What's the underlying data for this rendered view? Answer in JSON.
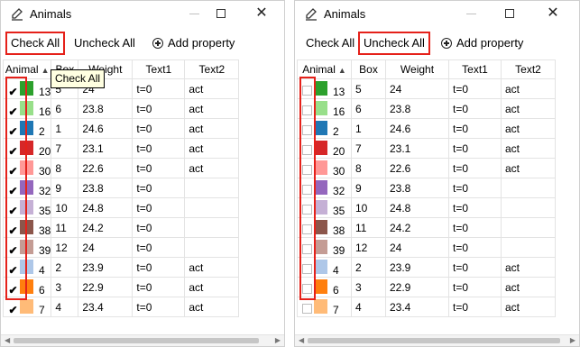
{
  "panels": [
    {
      "title": "Animals",
      "toolbar": {
        "check_all": "Check All",
        "uncheck_all": "Uncheck All",
        "add_property": "Add property"
      },
      "tooltip": "Check All",
      "checked": true
    },
    {
      "title": "Animals",
      "toolbar": {
        "check_all": "Check All",
        "uncheck_all": "Uncheck All",
        "add_property": "Add property"
      },
      "checked": false
    }
  ],
  "columns": [
    "Animal",
    "Box",
    "Weight",
    "Text1",
    "Text2"
  ],
  "sort_indicator": "▲",
  "checkmark": "✔",
  "rows": [
    {
      "color": "#2ca02c",
      "animal": "13",
      "box": "5",
      "weight": "24",
      "text1": "t=0",
      "text2": "act"
    },
    {
      "color": "#98df8a",
      "animal": "16",
      "box": "6",
      "weight": "23.8",
      "text1": "t=0",
      "text2": "act"
    },
    {
      "color": "#1f77b4",
      "animal": "2",
      "box": "1",
      "weight": "24.6",
      "text1": "t=0",
      "text2": "act"
    },
    {
      "color": "#d62728",
      "animal": "20",
      "box": "7",
      "weight": "23.1",
      "text1": "t=0",
      "text2": "act"
    },
    {
      "color": "#ff9896",
      "animal": "30",
      "box": "8",
      "weight": "22.6",
      "text1": "t=0",
      "text2": "act"
    },
    {
      "color": "#9467bd",
      "animal": "32",
      "box": "9",
      "weight": "23.8",
      "text1": "t=0",
      "text2": ""
    },
    {
      "color": "#c5b0d5",
      "animal": "35",
      "box": "10",
      "weight": "24.8",
      "text1": "t=0",
      "text2": ""
    },
    {
      "color": "#8c564b",
      "animal": "38",
      "box": "11",
      "weight": "24.2",
      "text1": "t=0",
      "text2": ""
    },
    {
      "color": "#c49c94",
      "animal": "39",
      "box": "12",
      "weight": "24",
      "text1": "t=0",
      "text2": ""
    },
    {
      "color": "#aec7e8",
      "animal": "4",
      "box": "2",
      "weight": "23.9",
      "text1": "t=0",
      "text2": "act"
    },
    {
      "color": "#ff7f0e",
      "animal": "6",
      "box": "3",
      "weight": "22.9",
      "text1": "t=0",
      "text2": "act"
    },
    {
      "color": "#ffbb78",
      "animal": "7",
      "box": "4",
      "weight": "23.4",
      "text1": "t=0",
      "text2": "act"
    }
  ],
  "icons": {
    "app": "edit-pencil-icon",
    "minimize": "minimize-icon",
    "maximize": "maximize-icon",
    "close": "close-icon",
    "add": "plus-circle-icon"
  },
  "colors": {
    "highlight": "#e5211a",
    "tooltip_bg": "#ffffe1"
  }
}
